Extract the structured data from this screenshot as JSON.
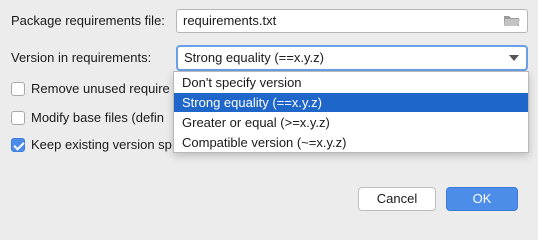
{
  "form": {
    "package_file": {
      "label": "Package requirements file:",
      "value": "requirements.txt"
    },
    "version": {
      "label": "Version in requirements:",
      "selected": "Strong equality (==x.y.z)"
    },
    "checkboxes": [
      {
        "label": "Remove unused require",
        "checked": false
      },
      {
        "label": "Modify base files (defin",
        "checked": false
      },
      {
        "label": "Keep existing version sp",
        "checked": true
      }
    ]
  },
  "dropdown": {
    "options": [
      {
        "label": "Don't specify version",
        "selected": false
      },
      {
        "label": "Strong equality (==x.y.z)",
        "selected": true
      },
      {
        "label": "Greater or equal (>=x.y.z)",
        "selected": false
      },
      {
        "label": "Compatible version (~=x.y.z)",
        "selected": false
      }
    ]
  },
  "buttons": {
    "cancel": "Cancel",
    "ok": "OK"
  },
  "colors": {
    "accent": "#4c8dea",
    "selection": "#1e66c9",
    "background": "#ececec"
  },
  "icons": {
    "browse": "folder-icon",
    "expand": "chevron-down-icon",
    "check": "checkmark-icon"
  }
}
